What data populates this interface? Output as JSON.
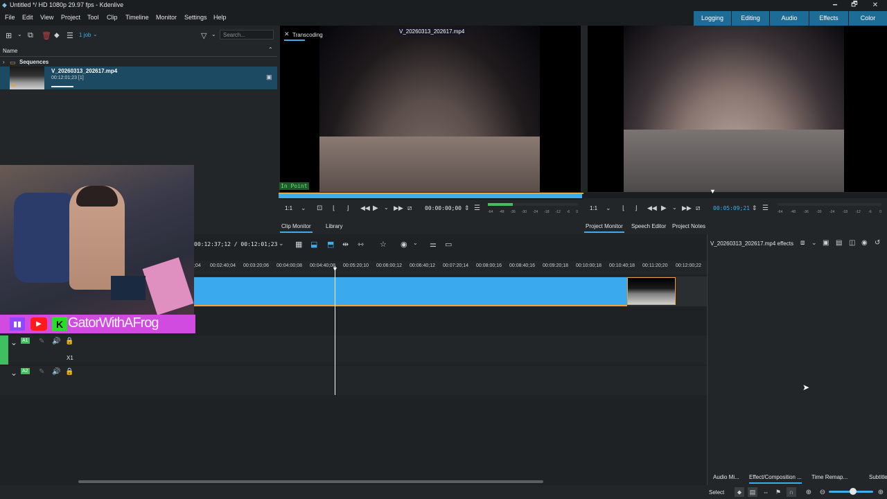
{
  "window": {
    "title": "Untitled */ HD 1080p 29.97 fps - Kdenlive",
    "minimize": "🗕",
    "maximize": "🗗",
    "close": "✕"
  },
  "menu": [
    "File",
    "Edit",
    "View",
    "Project",
    "Tool",
    "Clip",
    "Timeline",
    "Monitor",
    "Settings",
    "Help"
  ],
  "workspaces": [
    "Logging",
    "Editing",
    "Audio",
    "Effects",
    "Color"
  ],
  "bin": {
    "job_label": "1 job",
    "search_placeholder": "Search...",
    "column_name": "Name",
    "folder": "Sequences",
    "clip_name": "V_20260313_202617.mp4",
    "clip_duration": "00:12:01;23 [1]"
  },
  "clip_monitor": {
    "transcoding": "Transcoding",
    "clip_title": "V_20260313_202617.mp4",
    "in_point": "In Point",
    "zoom": "1:1",
    "timecode": "00:00:00;00",
    "audio_ticks": [
      "-64",
      "-48",
      "-36",
      "-30",
      "-24",
      "-18",
      "-12",
      "-6",
      "0"
    ]
  },
  "project_monitor": {
    "zoom": "1:1",
    "timecode": "00:05:09;21",
    "audio_ticks": [
      "-64",
      "-48",
      "-36",
      "-30",
      "-24",
      "-18",
      "-12",
      "-6",
      "0"
    ]
  },
  "monitor_tabs": {
    "left": [
      "Clip Monitor",
      "Library"
    ],
    "right": [
      "Project Monitor",
      "Speech Editor",
      "Project Notes"
    ]
  },
  "timeline": {
    "position": "00:12:37;12 / 00:12:01;23",
    "ruler": [
      ";04",
      "00:02:40;04",
      "00:03:20;06",
      "00:04:00;08",
      "00:04:40;08",
      "00:05:20;10",
      "00:06:00;12",
      "00:06:40;12",
      "00:07:20;14",
      "00:08:00;16",
      "00:08:40;16",
      "00:09:20;18",
      "00:10:00;18",
      "00:10:40;18",
      "00:11:20;20",
      "00:12:00;22"
    ],
    "tracks": {
      "a1": "A1",
      "a2": "A2",
      "sync_label": "X1"
    }
  },
  "webcam_overlay": {
    "channel_name": "GatorWithAFrog"
  },
  "effects_panel": {
    "title": "V_20260313_202617.mp4 effects",
    "tabs": [
      "Audio Mi...",
      "Effect/Composition ...",
      "Time Remap...",
      "Subtitles"
    ]
  },
  "statusbar": {
    "mode": "Select",
    "zoom_slider_level": 0.55
  },
  "colors": {
    "accent": "#3daee9",
    "workspace_tab_bg": "#1d6c95",
    "clip_blue": "#3aa9ee",
    "clip_border": "#f0a13c",
    "banner": "#d24be0",
    "track_green": "#3fbf5f"
  }
}
